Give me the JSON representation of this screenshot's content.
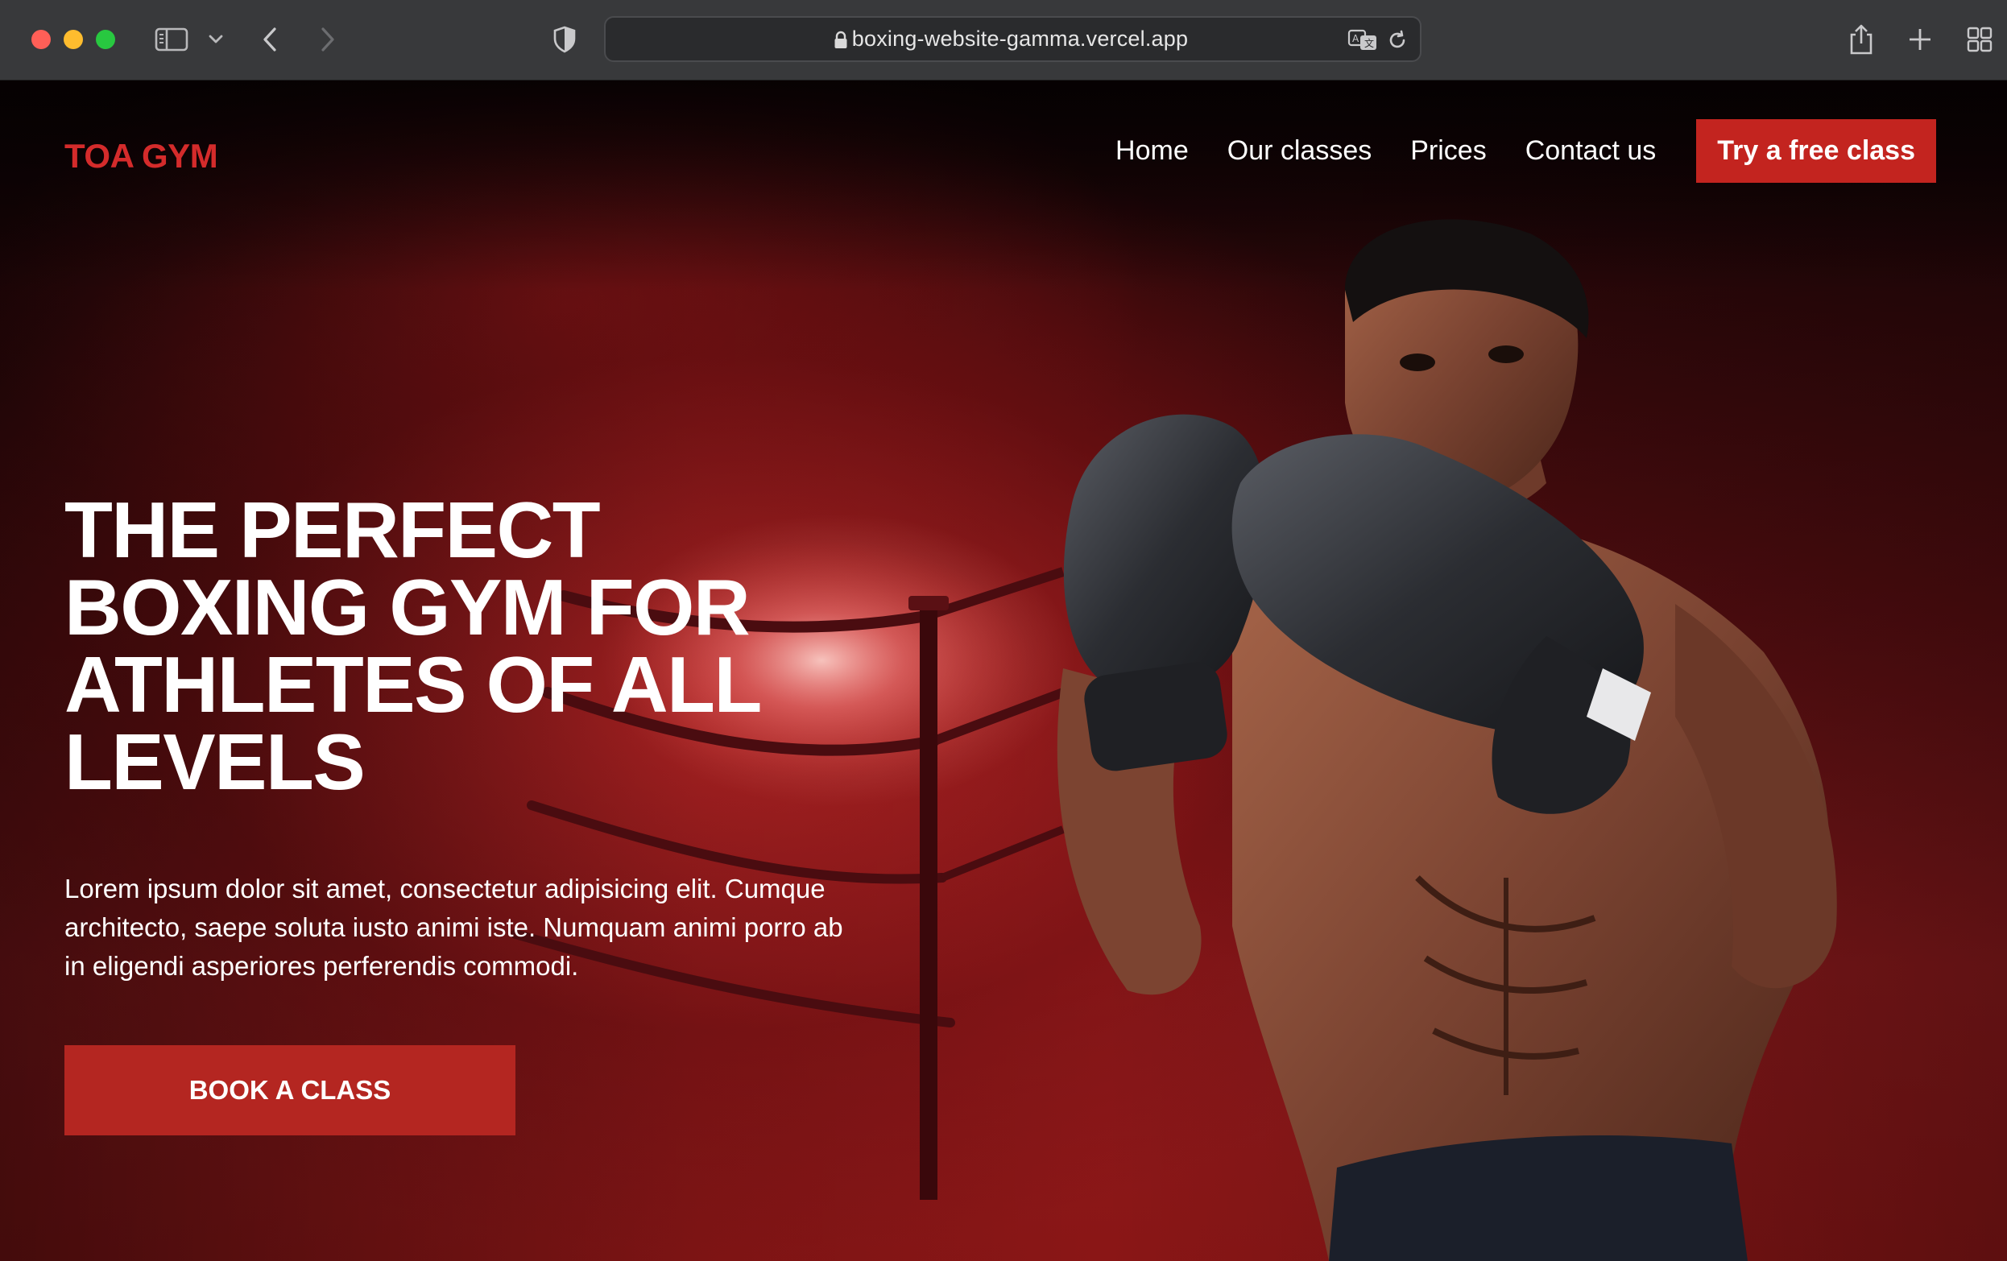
{
  "browser": {
    "url": "boxing-website-gamma.vercel.app",
    "icons": [
      "close-dot",
      "minimize-dot",
      "zoom-dot",
      "sidebar-icon",
      "chevron-down-icon",
      "back-icon",
      "forward-icon",
      "shield-icon",
      "lock-icon",
      "translate-icon",
      "reload-icon",
      "share-icon",
      "plus-icon",
      "tab-overview-icon"
    ]
  },
  "site": {
    "logo": "TOA GYM",
    "nav": {
      "items": [
        "Home",
        "Our classes",
        "Prices",
        "Contact us"
      ],
      "cta": "Try a free class"
    },
    "hero": {
      "title": "THE PERFECT BOXING GYM FOR ATHLETES OF ALL LEVELS",
      "body": "Lorem ipsum dolor sit amet, consectetur adipisicing elit. Cumque architecto, saepe soluta iusto animi iste. Numquam animi porro ab in eligendi asperiores perferendis commodi.",
      "button": "BOOK A CLASS"
    }
  },
  "colors": {
    "brand_red": "#d42b2b",
    "button_red": "#c3241f",
    "chrome_bg": "#38393b"
  }
}
